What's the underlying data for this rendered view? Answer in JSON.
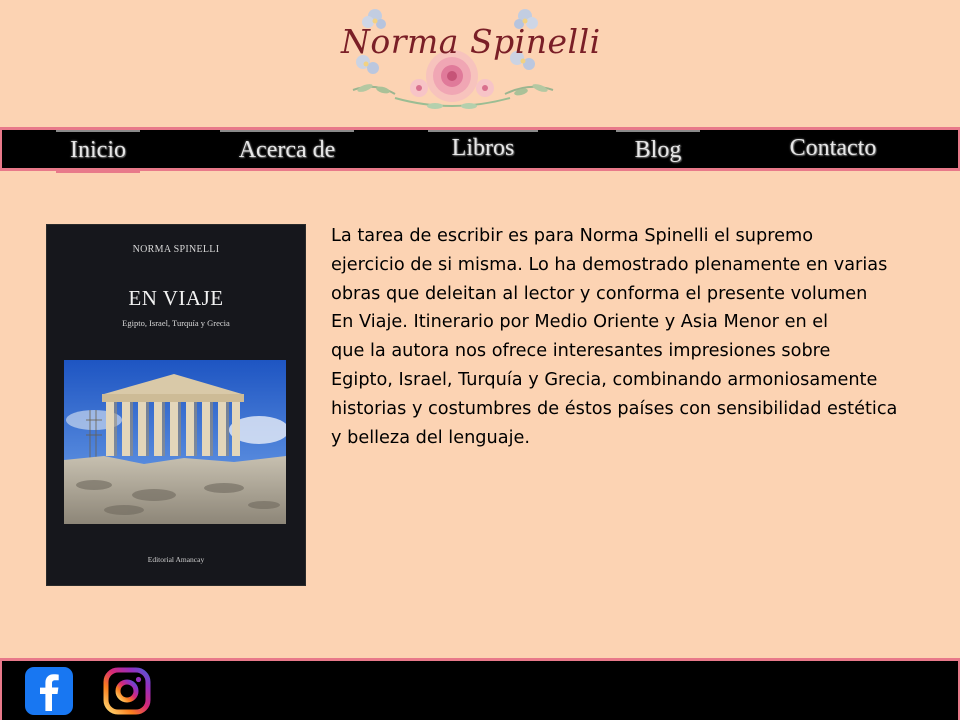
{
  "header": {
    "logo_text": "Norma Spinelli"
  },
  "nav": {
    "items": [
      {
        "label": "Inicio",
        "active": true
      },
      {
        "label": "Acerca de"
      },
      {
        "label": "Libros"
      },
      {
        "label": "Blog"
      },
      {
        "label": "Contacto"
      }
    ]
  },
  "book": {
    "author": "NORMA SPINELLI",
    "title": "EN VIAJE",
    "subtitle": "Egipto, Israel, Turquía y Grecia",
    "publisher": "Editorial Amancay",
    "description_lines": [
      "La tarea de escribir es para Norma Spinelli el supremo",
      "ejercicio de si misma. Lo ha demostrado plenamente en varias",
      "obras que deleitan al lector y conforma el presente volumen",
      "En Viaje. Itinerario por Medio Oriente y Asia Menor en el",
      "que la autora nos ofrece interesantes impresiones sobre",
      "Egipto, Israel, Turquía y Grecia, combinando armoniosamente",
      "historias y costumbres de éstos países con sensibilidad estética",
      "y belleza del lenguaje."
    ]
  },
  "footer": {
    "social": [
      {
        "icon": "facebook-icon",
        "color": "#1877f2"
      },
      {
        "icon": "instagram-icon",
        "colors": [
          "#feda75",
          "#fa7e1e",
          "#d62976",
          "#962fbf",
          "#4f5bd5"
        ]
      }
    ]
  },
  "colors": {
    "background": "#fcd3b3",
    "bar": "#000000",
    "accent_border": "#e8798a",
    "logo_text": "#7a1f27"
  }
}
